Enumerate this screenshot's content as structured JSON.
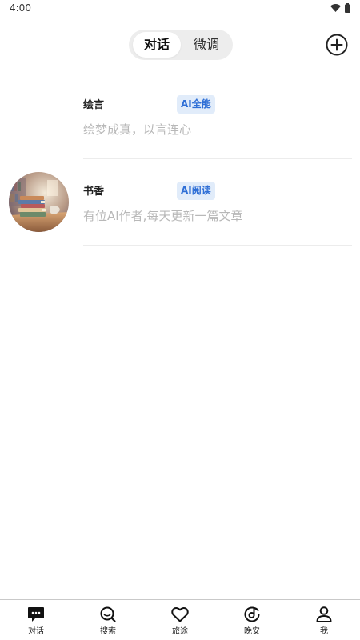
{
  "status_bar": {
    "time": "4:00",
    "icons": [
      "wifi-icon",
      "battery-icon"
    ]
  },
  "header": {
    "tabs": [
      {
        "label": "对话",
        "active": true
      },
      {
        "label": "微调",
        "active": false
      }
    ],
    "add_icon": "plus-circle-icon"
  },
  "chats": [
    {
      "name": "绘言",
      "badge": "AI全能",
      "description": "绘梦成真，以言连心",
      "has_avatar": false
    },
    {
      "name": "书香",
      "badge": "AI阅读",
      "description": "有位AI作者,每天更新一篇文章",
      "has_avatar": true,
      "avatar_icon": "books-illustration"
    }
  ],
  "bottom_nav": [
    {
      "label": "对话",
      "icon": "chat-bubble-icon",
      "active": true
    },
    {
      "label": "搜索",
      "icon": "search-icon",
      "active": false
    },
    {
      "label": "旅途",
      "icon": "heart-icon",
      "active": false
    },
    {
      "label": "晚安",
      "icon": "music-disc-icon",
      "active": false
    },
    {
      "label": "我",
      "icon": "user-icon",
      "active": false
    }
  ],
  "colors": {
    "badge_bg": "#e1ecfa",
    "badge_text": "#2f6fd6",
    "description_text": "#b8b8b8",
    "segmented_bg": "#ededed"
  }
}
